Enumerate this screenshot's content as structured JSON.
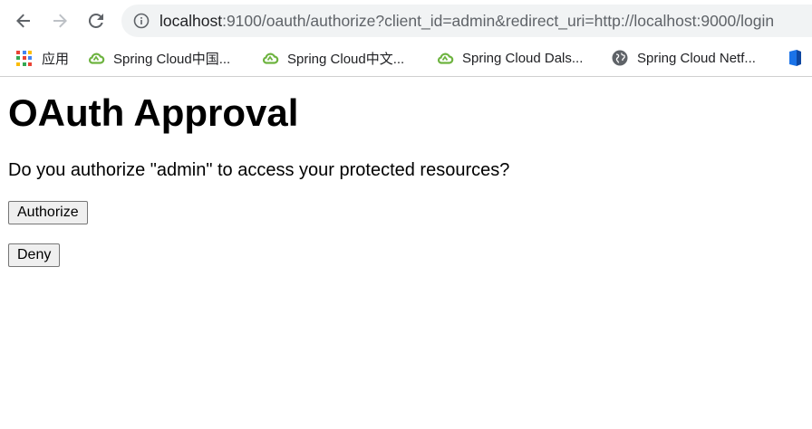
{
  "browser": {
    "url_host": "localhost",
    "url_rest": ":9100/oauth/authorize?client_id=admin&redirect_uri=http://localhost:9000/login"
  },
  "bookmarks": {
    "apps_label": "应用",
    "items": [
      {
        "label": "Spring Cloud中国...",
        "icon": "spring-cloud-icon"
      },
      {
        "label": "Spring Cloud中文...",
        "icon": "spring-cloud-icon"
      },
      {
        "label": "Spring Cloud Dals...",
        "icon": "spring-cloud-icon"
      },
      {
        "label": "Spring Cloud Netf...",
        "icon": "globe-icon"
      },
      {
        "label": "",
        "icon": "bookmark-app-icon"
      }
    ]
  },
  "page": {
    "title": "OAuth Approval",
    "question": "Do you authorize \"admin\" to access your protected resources?",
    "authorize_label": "Authorize",
    "deny_label": "Deny"
  },
  "colors": {
    "spring_green": "#6db33f",
    "omnibox_bg": "#f1f3f4",
    "nav_icon": "#5f6368",
    "nav_icon_disabled": "#bdc1c6"
  }
}
